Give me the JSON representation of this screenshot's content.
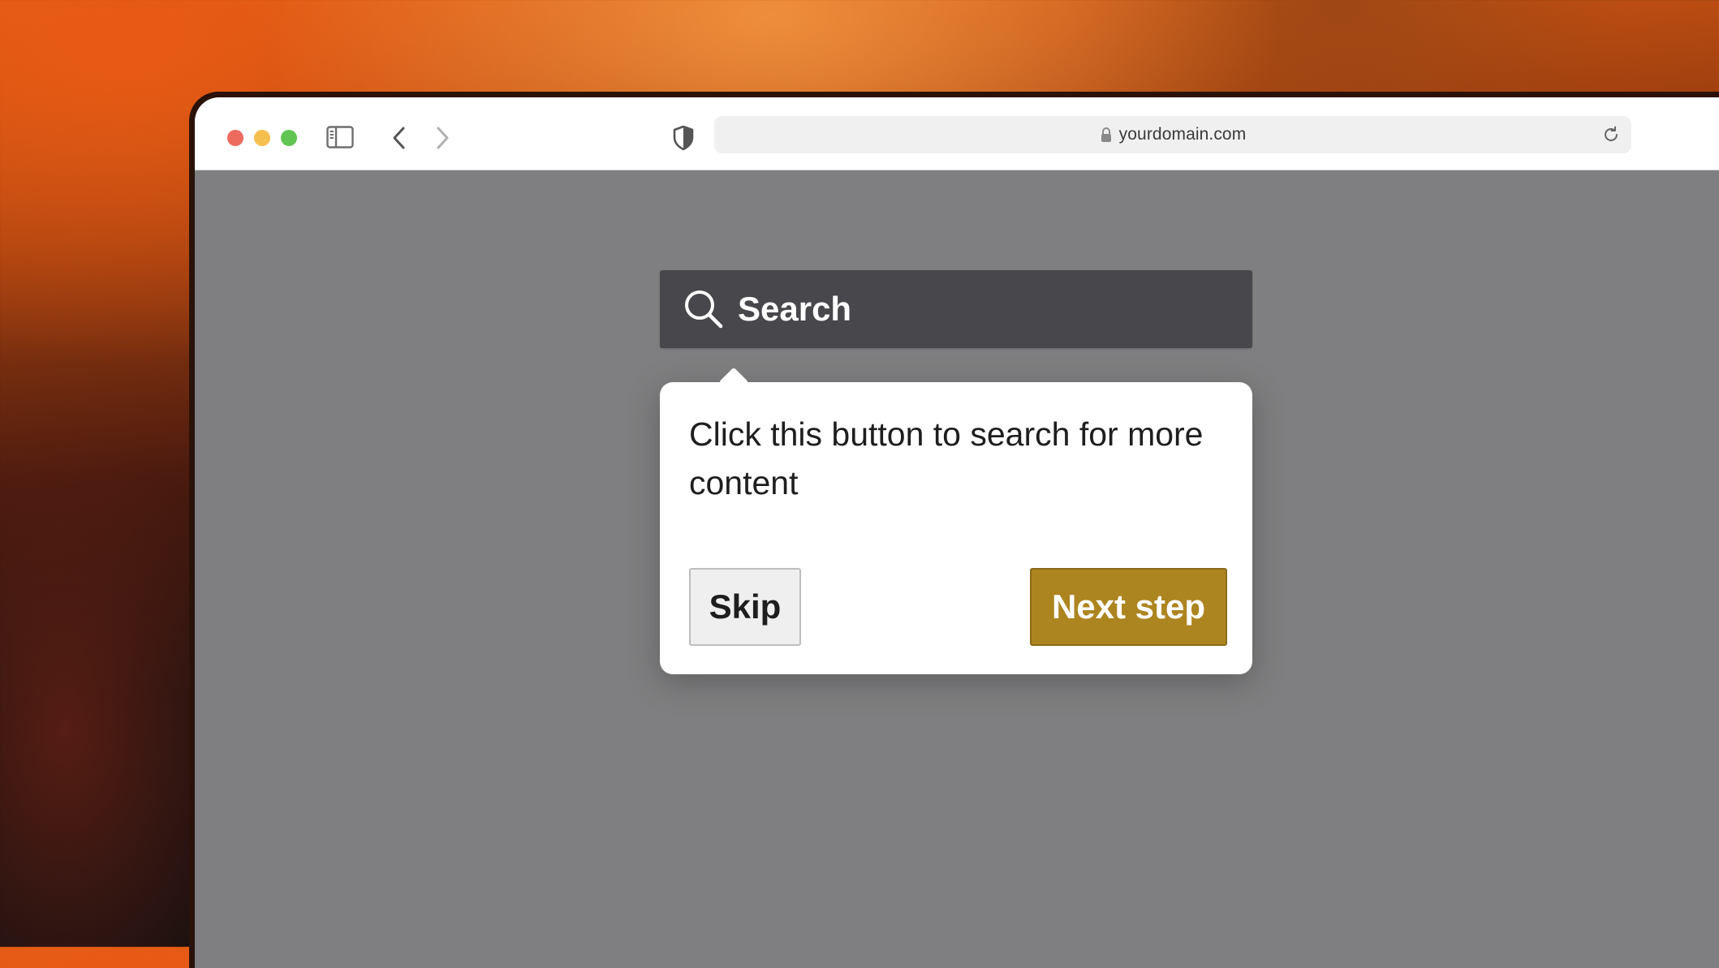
{
  "browser": {
    "url": "yourdomain.com",
    "icons": {
      "sidebar": "sidebar-icon",
      "back": "chevron-left-icon",
      "forward": "chevron-right-icon",
      "privacy": "shield-icon",
      "lock": "lock-icon",
      "reload": "reload-icon"
    }
  },
  "page": {
    "search_button": {
      "label": "Search",
      "icon": "search-icon"
    },
    "tour_popover": {
      "message": "Click this button to search for more content",
      "skip_label": "Skip",
      "next_label": "Next step"
    }
  },
  "colors": {
    "accent": "#ad8520",
    "search_bg": "#48484c",
    "page_bg": "#7f7f81"
  }
}
